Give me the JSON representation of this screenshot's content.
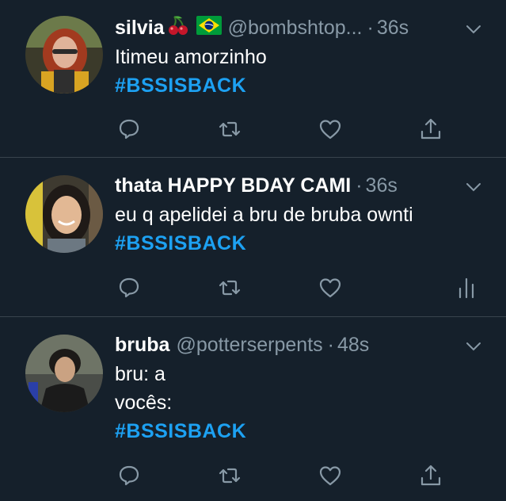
{
  "tweets": [
    {
      "name": "silvia",
      "handle": "@bombshtop...",
      "time": "36s",
      "lines": [
        "Itimeu amorzinho"
      ],
      "hashtag": "#BSSISBACK",
      "actions": [
        "reply-icon",
        "retweet-icon",
        "like-icon",
        "share-icon"
      ]
    },
    {
      "name": "thata HAPPY BDAY CAMI",
      "handle": "",
      "time": "36s",
      "lines": [
        "eu q apelidei a bru de bruba ownti"
      ],
      "hashtag": "#BSSISBACK",
      "actions": [
        "reply-icon",
        "retweet-icon",
        "like-icon",
        "analytics-icon"
      ]
    },
    {
      "name": "bruba",
      "handle": "@potterserpents",
      "time": "48s",
      "lines": [
        "bru: a",
        "vocês:"
      ],
      "hashtag": "#BSSISBACK",
      "actions": [
        "reply-icon",
        "retweet-icon",
        "like-icon",
        "share-icon"
      ]
    }
  ],
  "colors": {
    "background": "#15202b",
    "divider": "#38444d",
    "muted": "#8899a6",
    "hashtag": "#1da1f2"
  }
}
